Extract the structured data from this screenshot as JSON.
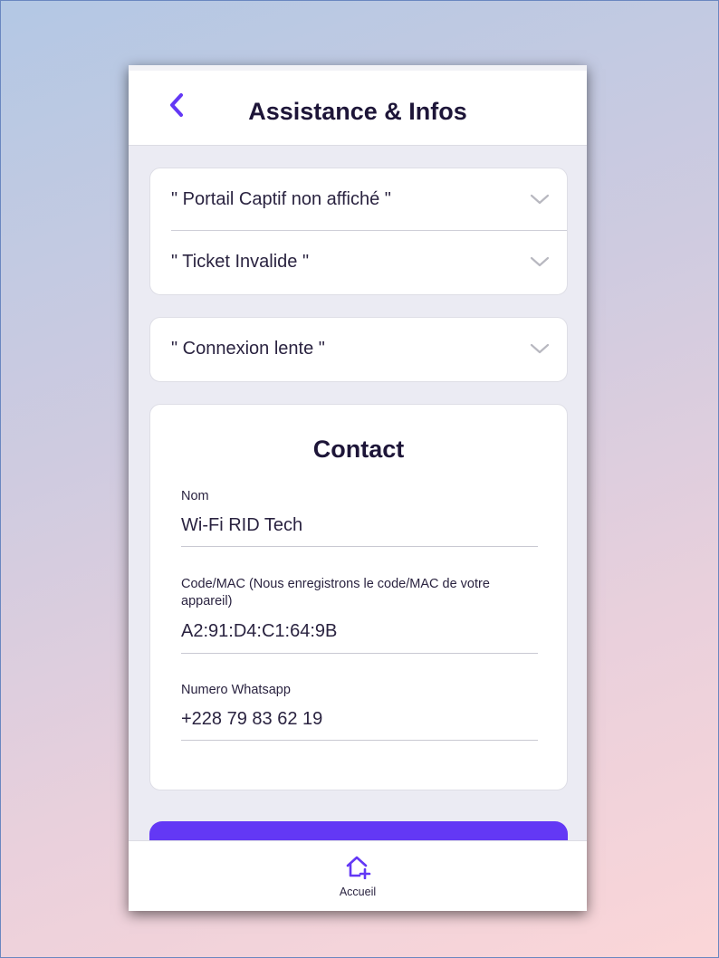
{
  "header": {
    "title": "Assistance & Infos"
  },
  "faq_group_1": [
    {
      "label": "\" Portail Captif non affiché \""
    },
    {
      "label": "\" Ticket Invalide \""
    }
  ],
  "faq_group_2": [
    {
      "label": "\" Connexion lente \""
    }
  ],
  "contact": {
    "title": "Contact",
    "name_label": "Nom",
    "name_value": "Wi-Fi RID Tech",
    "code_label": "Code/MAC (Nous enregistrons le code/MAC de votre appareil)",
    "code_value": "A2:91:D4:C1:64:9B",
    "whatsapp_label": "Numero Whatsapp",
    "whatsapp_value": "+228 79 83 62 19"
  },
  "bottom_nav": {
    "home_label": "Accueil"
  },
  "colors": {
    "accent": "#6338f5",
    "title_text": "#1d1538",
    "phone_background": "#ebebf3"
  },
  "icons": {
    "back": "chevron-left-icon",
    "accordion": "chevron-down-icon",
    "home": "home-plus-icon"
  }
}
